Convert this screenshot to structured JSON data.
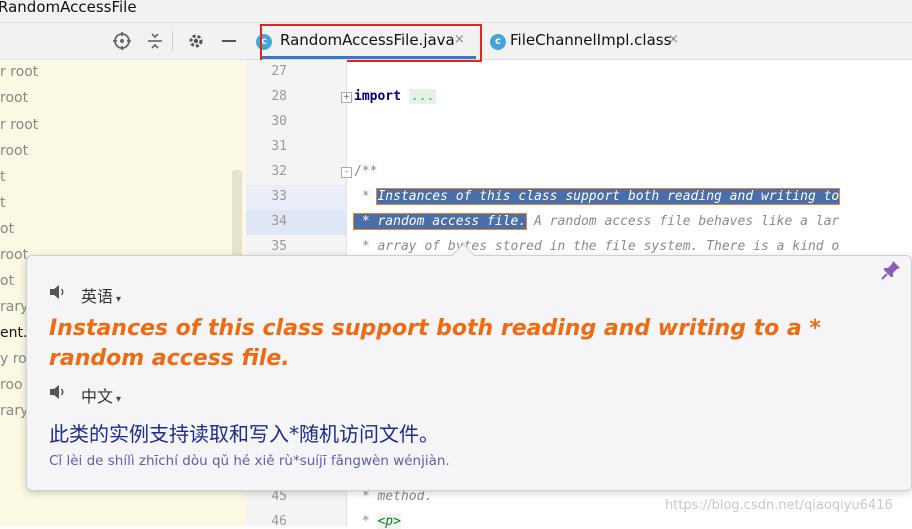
{
  "window": {
    "title": "RandomAccessFile"
  },
  "left_tree": {
    "items": [
      "r root",
      "root",
      "r root",
      "root",
      "t",
      "t",
      "ot",
      "root",
      "ot",
      "rary",
      "ent.j",
      "y root",
      "roo",
      "rary"
    ]
  },
  "tabs": [
    {
      "label": "RandomAccessFile.java",
      "icon": "class-icon",
      "close": "×",
      "active": true
    },
    {
      "label": "FileChannelImpl.class",
      "icon": "class-icon",
      "close": "×",
      "active": false
    }
  ],
  "editor": {
    "line_numbers": [
      "27",
      "28",
      "30",
      "31",
      "32",
      "33",
      "34",
      "35",
      "45",
      "46"
    ],
    "code": {
      "import_kw": "import",
      "import_fold": "...",
      "doc_open": "/**",
      "l33_star": " * ",
      "l33_sel": "Instances of this class support both reading and writing to",
      "l34_sel": " * random access file.",
      "l34_rest": " A random access file behaves like a lar",
      "l35": " * array of bytes stored in the file system. There is a kind o",
      "l45": " * method.",
      "l46_star": " * ",
      "l46_tag": "<p>"
    }
  },
  "popup": {
    "src_lang": "英语",
    "src_text": "Instances of this class support both reading and writing to a * random access file.",
    "dst_lang": "中文",
    "dst_text": "此类的实例支持读取和写入*随机访问文件。",
    "pinyin": "Cǐ lèi de shílì zhīchí dòu qǔ hé xiě rù*suíjī fǎngwèn wénjiàn.",
    "caret": "▾"
  },
  "watermark": "https://blog.csdn.net/qiaoqiyu6416",
  "colors": {
    "accent": "#3a78c2",
    "source_text": "#ef6a10",
    "target_text": "#1b2b8f",
    "highlight_outline": "#e02424"
  }
}
